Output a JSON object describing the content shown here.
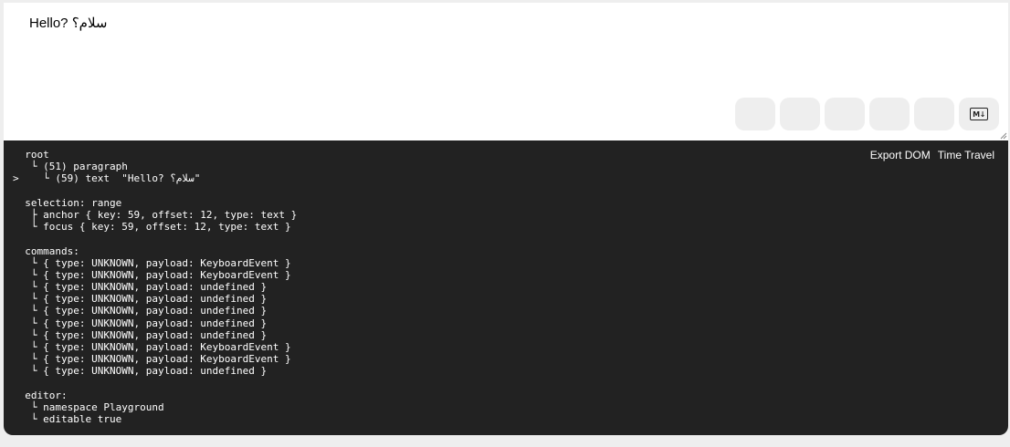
{
  "editor": {
    "text": "Hello? سلام؟"
  },
  "action_buttons": [
    {
      "name": "action-button-1"
    },
    {
      "name": "action-button-2"
    },
    {
      "name": "action-button-3"
    },
    {
      "name": "action-button-4"
    },
    {
      "name": "action-button-5"
    }
  ],
  "markdown_button": {
    "icon": "markdown-icon",
    "label": "M↓"
  },
  "tree_view": {
    "export_dom_label": "Export DOM",
    "time_travel_label": "Time Travel",
    "lines": [
      "  root",
      "   └ (51) paragraph",
      ">    └ (59) text  \"Hello? سلام؟\"",
      "",
      "  selection: range",
      "   ├ anchor { key: 59, offset: 12, type: text }",
      "   └ focus { key: 59, offset: 12, type: text }",
      "",
      "  commands:",
      "   └ { type: UNKNOWN, payload: KeyboardEvent }",
      "   └ { type: UNKNOWN, payload: KeyboardEvent }",
      "   └ { type: UNKNOWN, payload: undefined }",
      "   └ { type: UNKNOWN, payload: undefined }",
      "   └ { type: UNKNOWN, payload: undefined }",
      "   └ { type: UNKNOWN, payload: undefined }",
      "   └ { type: UNKNOWN, payload: undefined }",
      "   └ { type: UNKNOWN, payload: KeyboardEvent }",
      "   └ { type: UNKNOWN, payload: KeyboardEvent }",
      "   └ { type: UNKNOWN, payload: undefined }",
      "",
      "  editor:",
      "   └ namespace Playground",
      "   └ editable true"
    ]
  },
  "colors": {
    "page_bg": "#eeeeee",
    "editor_bg": "#ffffff",
    "tree_bg": "#222222",
    "button_bg": "#eeeeee"
  }
}
